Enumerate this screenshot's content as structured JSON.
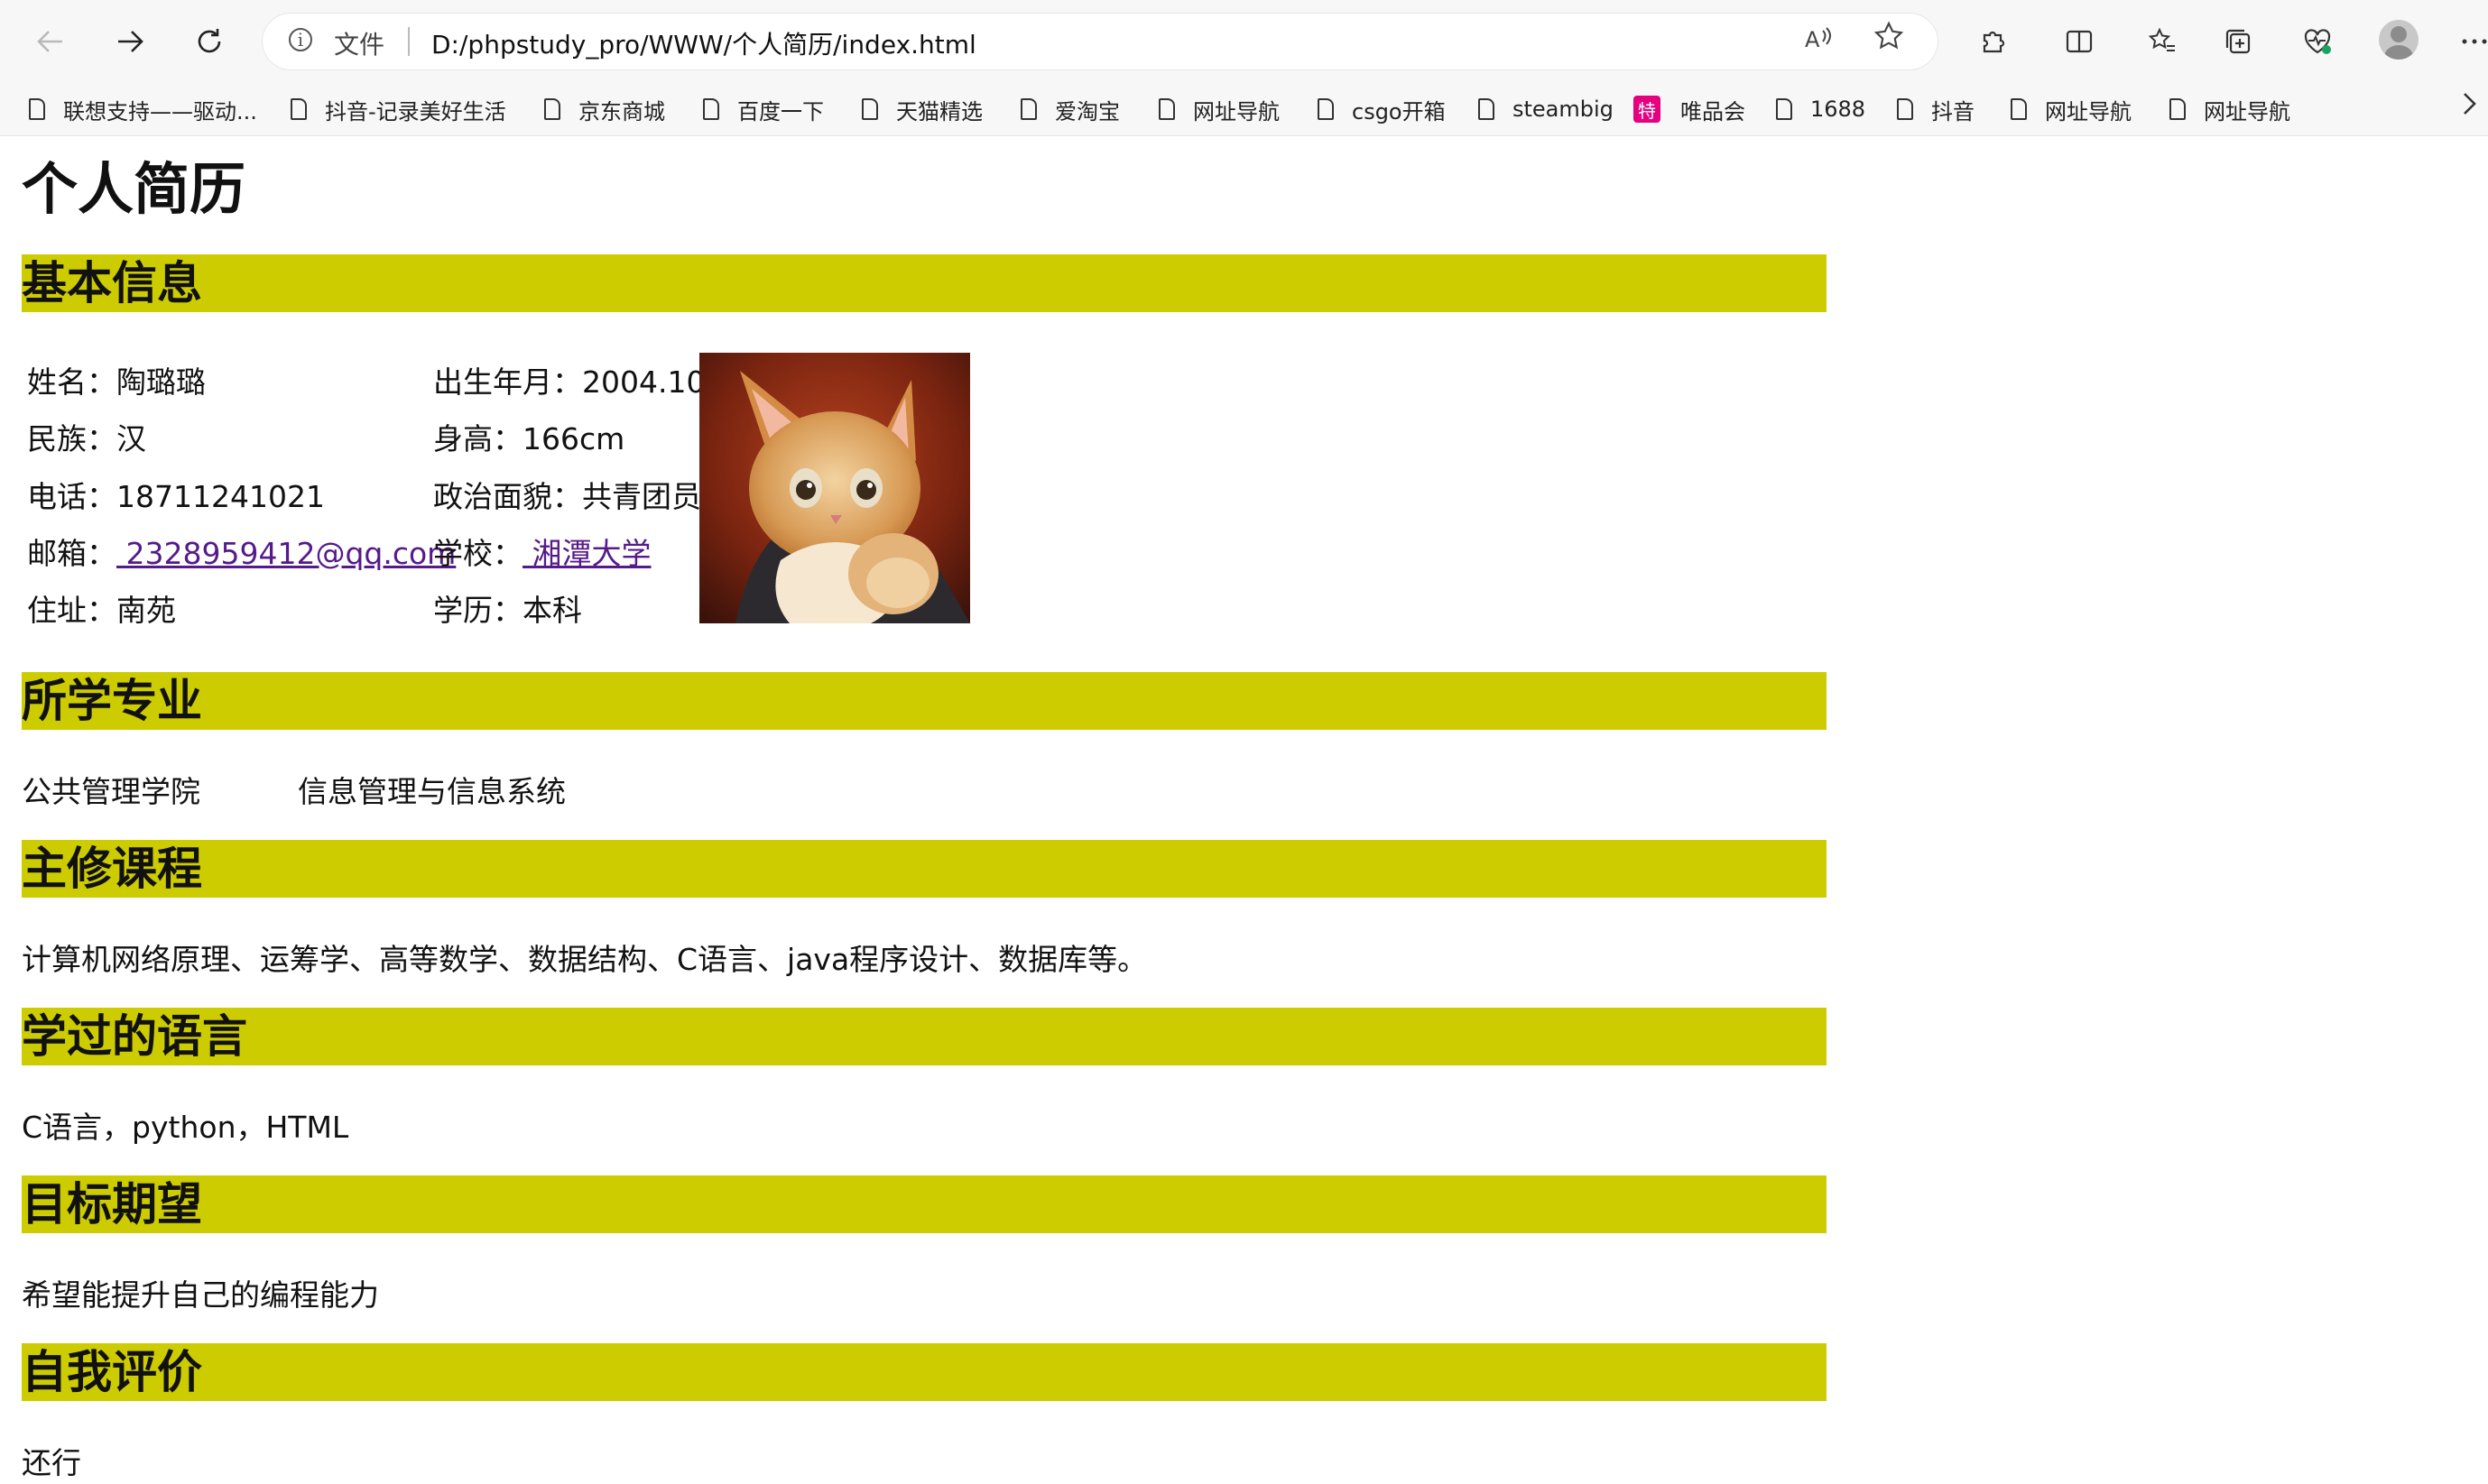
{
  "browser": {
    "file_label": "文件",
    "url": "D:/phpstudy_pro/WWW/个人简历/index.html",
    "read_aloud_label": "A⁾",
    "bookmarks": [
      "联想支持——驱动...",
      "抖音-记录美好生活",
      "京东商城",
      "百度一下",
      "天猫精选",
      "爱淘宝",
      "网址导航",
      "csgo开箱",
      "steambig",
      "唯品会",
      "1688",
      "抖音",
      "网址导航",
      "网址导航"
    ],
    "vip_icon_glyph": "特"
  },
  "resume": {
    "title": "个人简历",
    "sections": {
      "basic_info": "基本信息",
      "major": "所学专业",
      "courses": "主修课程",
      "languages": "学过的语言",
      "goals": "目标期望",
      "self_eval": "自我评价"
    },
    "basic": {
      "name_label": "姓名：",
      "name": "陶璐璐",
      "ethnicity_label": "民族：",
      "ethnicity": "汉",
      "phone_label": "电话：",
      "phone": "18711241021",
      "email_label": "邮箱：",
      "email": " 2328959412@qq.com",
      "address_label": "住址：",
      "address": "南苑",
      "birth_label": "出生年月：",
      "birth": "2004.10",
      "height_label": "身高：",
      "height": "166cm",
      "political_label": "政治面貌：",
      "political": "共青团员",
      "school_label": "学校：",
      "school": " 湘潭大学",
      "education_label": "学历：",
      "education": "本科"
    },
    "major": {
      "college": "公共管理学院",
      "program": "信息管理与信息系统"
    },
    "courses": "计算机网络原理、运筹学、高等数学、数据结构、C语言、java程序设计、数据库等。",
    "languages": "C语言，python，HTML",
    "goals": "希望能提升自己的编程能力",
    "self_eval": "还行"
  },
  "colors": {
    "section_bar": "#cccc00",
    "link": "#551a8b"
  }
}
